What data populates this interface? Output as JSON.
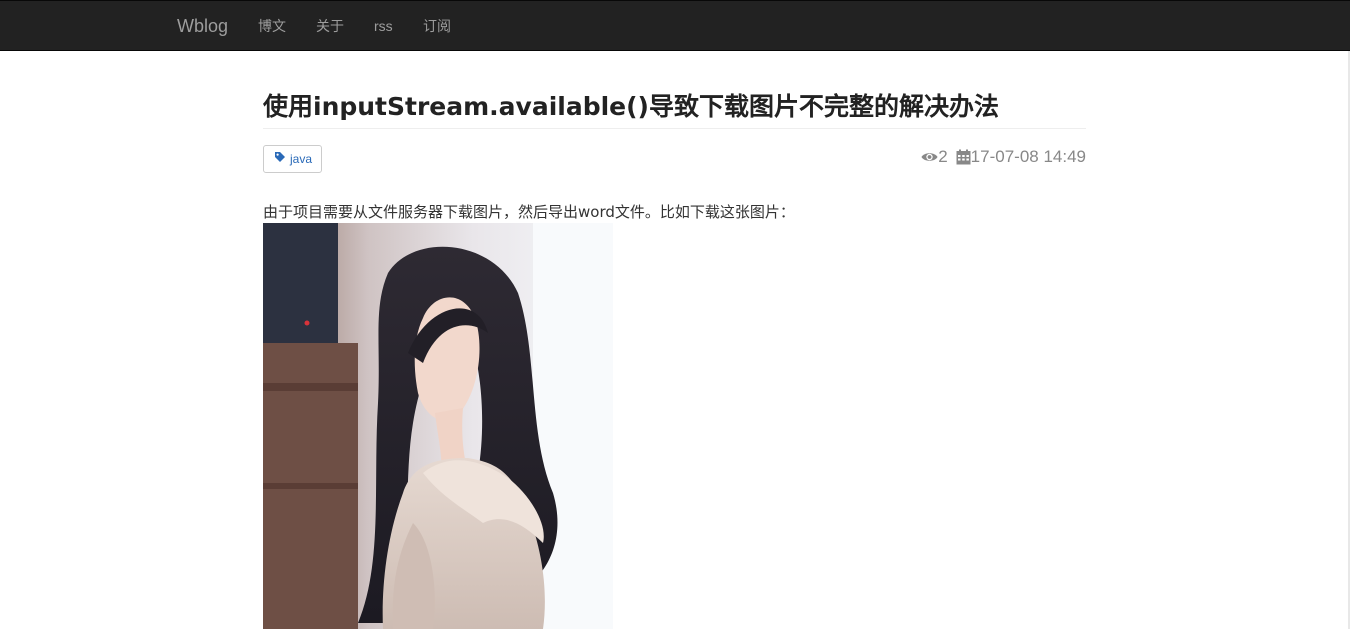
{
  "navbar": {
    "brand": "Wblog",
    "items": [
      {
        "label": "博文"
      },
      {
        "label": "关于"
      },
      {
        "label": "rss"
      },
      {
        "label": "订阅"
      }
    ]
  },
  "article": {
    "title": "使用inputStream.available()导致下载图片不完整的解决办法",
    "tag": {
      "label": "java",
      "icon": "tag-icon"
    },
    "views": "2",
    "date": "17-07-08 14:49",
    "intro": "由于项目需要从文件服务器下载图片，然后导出word文件。比如下载这张图片："
  },
  "colors": {
    "navbar_bg": "#222222",
    "nav_text": "#9d9d9d",
    "tag_text": "#2a6ab8",
    "meta_text": "#888888",
    "title_text": "#222222"
  }
}
